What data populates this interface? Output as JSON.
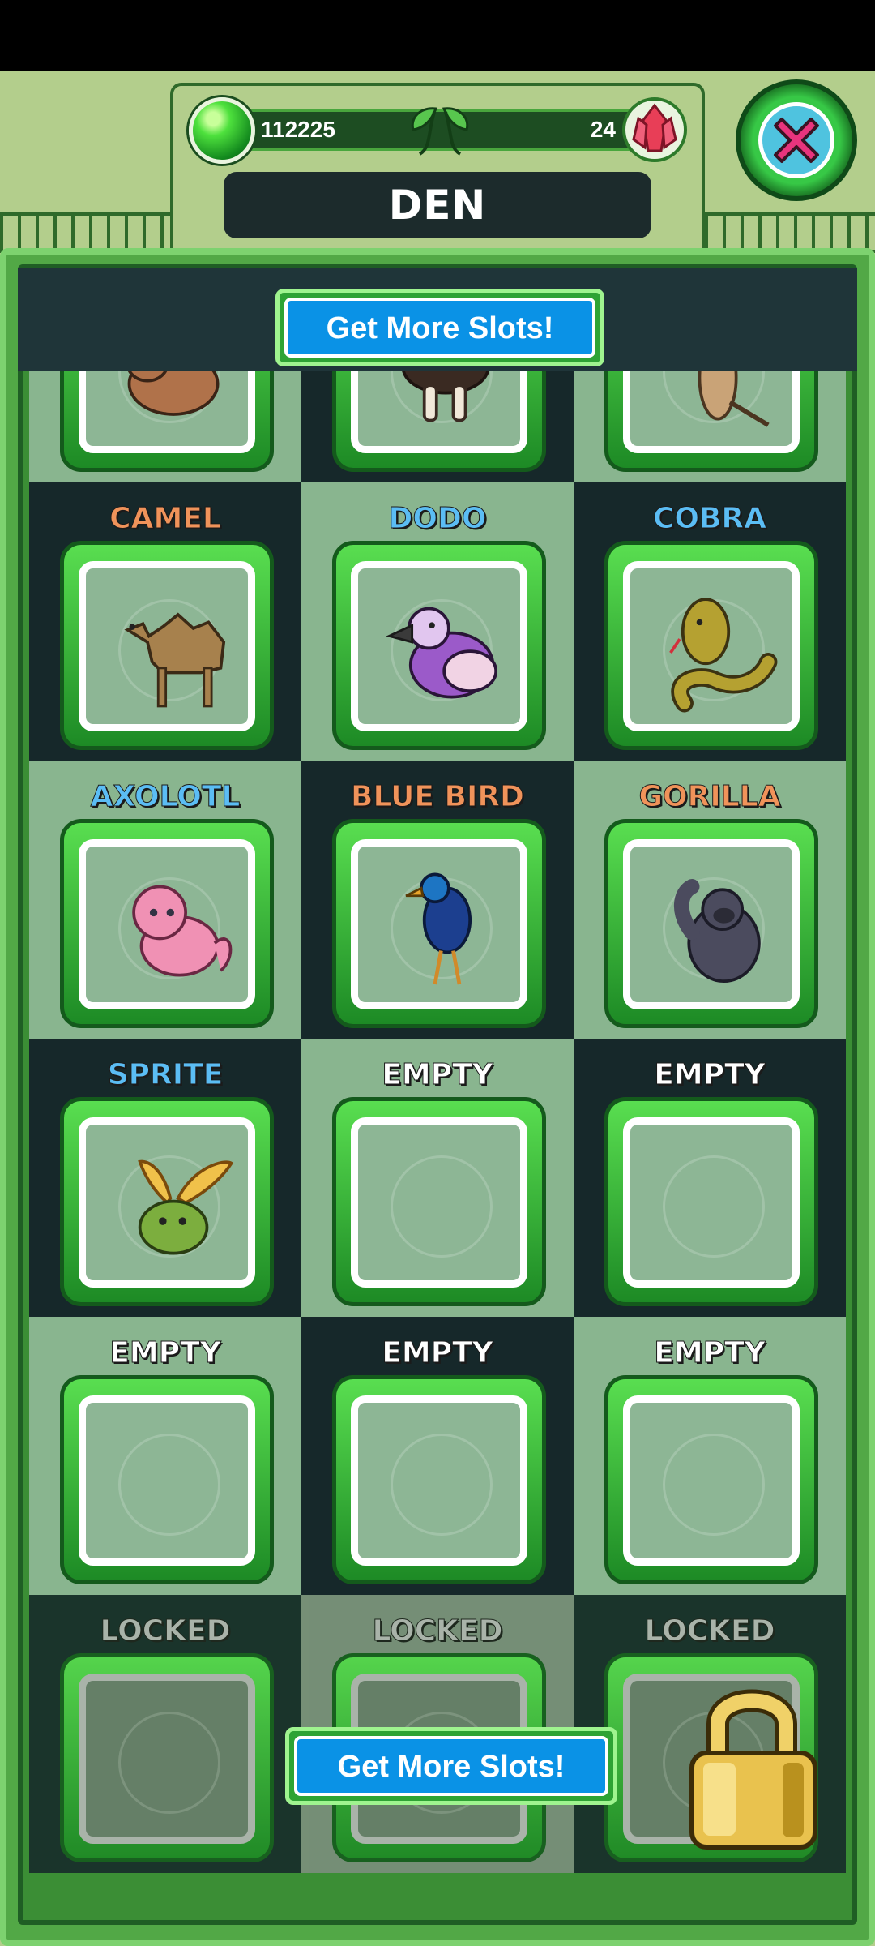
{
  "header": {
    "gem_count": "112225",
    "crystal_count": "24",
    "title": "DEN",
    "close_icon": "close-icon"
  },
  "actions": {
    "more_slots_top": "Get More Slots!",
    "more_slots_bottom": "Get More Slots!"
  },
  "colors": {
    "panel_green": "#52a846",
    "slot_dark": "#16282a",
    "slot_light": "#89b58f",
    "button_blue": "#0a92e6",
    "label_orange": "#f0935a",
    "label_blue": "#5bbdf4",
    "label_white": "#ffffff",
    "label_grey": "#b9b9b9"
  },
  "slots": [
    {
      "label": "",
      "color": "",
      "icon": "capybara-icon",
      "state": "filled"
    },
    {
      "label": "",
      "color": "",
      "icon": "ostrich-icon",
      "state": "filled"
    },
    {
      "label": "",
      "color": "",
      "icon": "meerkat-icon",
      "state": "filled"
    },
    {
      "label": "CAMEL",
      "color": "#f0935a",
      "icon": "camel-icon",
      "state": "filled"
    },
    {
      "label": "DODO",
      "color": "#5bbdf4",
      "icon": "dodo-icon",
      "state": "filled"
    },
    {
      "label": "COBRA",
      "color": "#5bbdf4",
      "icon": "cobra-icon",
      "state": "filled"
    },
    {
      "label": "AXOLOTL",
      "color": "#5bbdf4",
      "icon": "axolotl-icon",
      "state": "filled"
    },
    {
      "label": "BLUE BIRD",
      "color": "#f0935a",
      "icon": "blue-bird-icon",
      "state": "filled"
    },
    {
      "label": "GORILLA",
      "color": "#f0935a",
      "icon": "gorilla-icon",
      "state": "filled"
    },
    {
      "label": "SPRITE",
      "color": "#5bbdf4",
      "icon": "sprite-icon",
      "state": "filled"
    },
    {
      "label": "EMPTY",
      "color": "#ffffff",
      "icon": "",
      "state": "empty"
    },
    {
      "label": "EMPTY",
      "color": "#ffffff",
      "icon": "",
      "state": "empty"
    },
    {
      "label": "EMPTY",
      "color": "#ffffff",
      "icon": "",
      "state": "empty"
    },
    {
      "label": "EMPTY",
      "color": "#ffffff",
      "icon": "",
      "state": "empty"
    },
    {
      "label": "EMPTY",
      "color": "#ffffff",
      "icon": "",
      "state": "empty"
    },
    {
      "label": "LOCKED",
      "color": "#b9b9b9",
      "icon": "",
      "state": "locked"
    },
    {
      "label": "LOCKED",
      "color": "#b9b9b9",
      "icon": "",
      "state": "locked"
    },
    {
      "label": "LOCKED",
      "color": "#b9b9b9",
      "icon": "",
      "state": "locked"
    }
  ]
}
